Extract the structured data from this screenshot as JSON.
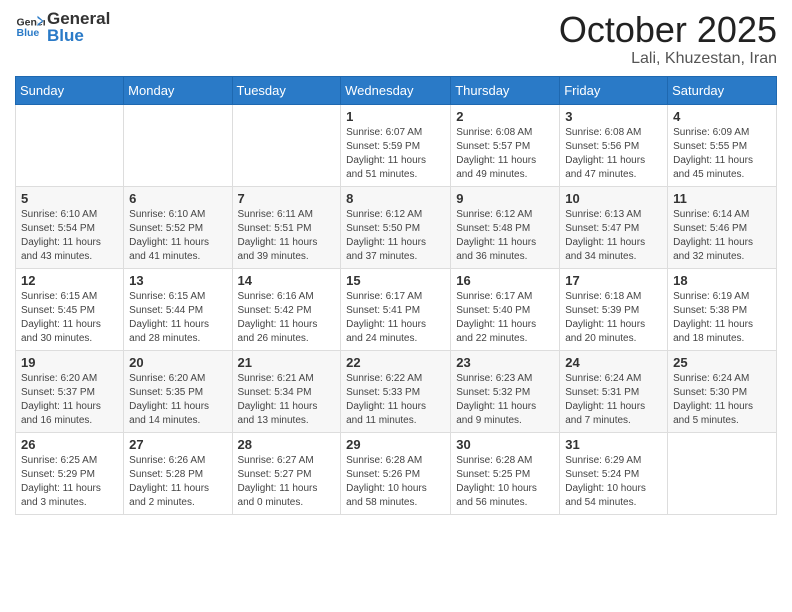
{
  "logo": {
    "general": "General",
    "blue": "Blue"
  },
  "header": {
    "month": "October 2025",
    "location": "Lali, Khuzestan, Iran"
  },
  "weekdays": [
    "Sunday",
    "Monday",
    "Tuesday",
    "Wednesday",
    "Thursday",
    "Friday",
    "Saturday"
  ],
  "weeks": [
    [
      {
        "day": "",
        "sunrise": "",
        "sunset": "",
        "daylight": ""
      },
      {
        "day": "",
        "sunrise": "",
        "sunset": "",
        "daylight": ""
      },
      {
        "day": "",
        "sunrise": "",
        "sunset": "",
        "daylight": ""
      },
      {
        "day": "1",
        "sunrise": "Sunrise: 6:07 AM",
        "sunset": "Sunset: 5:59 PM",
        "daylight": "Daylight: 11 hours and 51 minutes."
      },
      {
        "day": "2",
        "sunrise": "Sunrise: 6:08 AM",
        "sunset": "Sunset: 5:57 PM",
        "daylight": "Daylight: 11 hours and 49 minutes."
      },
      {
        "day": "3",
        "sunrise": "Sunrise: 6:08 AM",
        "sunset": "Sunset: 5:56 PM",
        "daylight": "Daylight: 11 hours and 47 minutes."
      },
      {
        "day": "4",
        "sunrise": "Sunrise: 6:09 AM",
        "sunset": "Sunset: 5:55 PM",
        "daylight": "Daylight: 11 hours and 45 minutes."
      }
    ],
    [
      {
        "day": "5",
        "sunrise": "Sunrise: 6:10 AM",
        "sunset": "Sunset: 5:54 PM",
        "daylight": "Daylight: 11 hours and 43 minutes."
      },
      {
        "day": "6",
        "sunrise": "Sunrise: 6:10 AM",
        "sunset": "Sunset: 5:52 PM",
        "daylight": "Daylight: 11 hours and 41 minutes."
      },
      {
        "day": "7",
        "sunrise": "Sunrise: 6:11 AM",
        "sunset": "Sunset: 5:51 PM",
        "daylight": "Daylight: 11 hours and 39 minutes."
      },
      {
        "day": "8",
        "sunrise": "Sunrise: 6:12 AM",
        "sunset": "Sunset: 5:50 PM",
        "daylight": "Daylight: 11 hours and 37 minutes."
      },
      {
        "day": "9",
        "sunrise": "Sunrise: 6:12 AM",
        "sunset": "Sunset: 5:48 PM",
        "daylight": "Daylight: 11 hours and 36 minutes."
      },
      {
        "day": "10",
        "sunrise": "Sunrise: 6:13 AM",
        "sunset": "Sunset: 5:47 PM",
        "daylight": "Daylight: 11 hours and 34 minutes."
      },
      {
        "day": "11",
        "sunrise": "Sunrise: 6:14 AM",
        "sunset": "Sunset: 5:46 PM",
        "daylight": "Daylight: 11 hours and 32 minutes."
      }
    ],
    [
      {
        "day": "12",
        "sunrise": "Sunrise: 6:15 AM",
        "sunset": "Sunset: 5:45 PM",
        "daylight": "Daylight: 11 hours and 30 minutes."
      },
      {
        "day": "13",
        "sunrise": "Sunrise: 6:15 AM",
        "sunset": "Sunset: 5:44 PM",
        "daylight": "Daylight: 11 hours and 28 minutes."
      },
      {
        "day": "14",
        "sunrise": "Sunrise: 6:16 AM",
        "sunset": "Sunset: 5:42 PM",
        "daylight": "Daylight: 11 hours and 26 minutes."
      },
      {
        "day": "15",
        "sunrise": "Sunrise: 6:17 AM",
        "sunset": "Sunset: 5:41 PM",
        "daylight": "Daylight: 11 hours and 24 minutes."
      },
      {
        "day": "16",
        "sunrise": "Sunrise: 6:17 AM",
        "sunset": "Sunset: 5:40 PM",
        "daylight": "Daylight: 11 hours and 22 minutes."
      },
      {
        "day": "17",
        "sunrise": "Sunrise: 6:18 AM",
        "sunset": "Sunset: 5:39 PM",
        "daylight": "Daylight: 11 hours and 20 minutes."
      },
      {
        "day": "18",
        "sunrise": "Sunrise: 6:19 AM",
        "sunset": "Sunset: 5:38 PM",
        "daylight": "Daylight: 11 hours and 18 minutes."
      }
    ],
    [
      {
        "day": "19",
        "sunrise": "Sunrise: 6:20 AM",
        "sunset": "Sunset: 5:37 PM",
        "daylight": "Daylight: 11 hours and 16 minutes."
      },
      {
        "day": "20",
        "sunrise": "Sunrise: 6:20 AM",
        "sunset": "Sunset: 5:35 PM",
        "daylight": "Daylight: 11 hours and 14 minutes."
      },
      {
        "day": "21",
        "sunrise": "Sunrise: 6:21 AM",
        "sunset": "Sunset: 5:34 PM",
        "daylight": "Daylight: 11 hours and 13 minutes."
      },
      {
        "day": "22",
        "sunrise": "Sunrise: 6:22 AM",
        "sunset": "Sunset: 5:33 PM",
        "daylight": "Daylight: 11 hours and 11 minutes."
      },
      {
        "day": "23",
        "sunrise": "Sunrise: 6:23 AM",
        "sunset": "Sunset: 5:32 PM",
        "daylight": "Daylight: 11 hours and 9 minutes."
      },
      {
        "day": "24",
        "sunrise": "Sunrise: 6:24 AM",
        "sunset": "Sunset: 5:31 PM",
        "daylight": "Daylight: 11 hours and 7 minutes."
      },
      {
        "day": "25",
        "sunrise": "Sunrise: 6:24 AM",
        "sunset": "Sunset: 5:30 PM",
        "daylight": "Daylight: 11 hours and 5 minutes."
      }
    ],
    [
      {
        "day": "26",
        "sunrise": "Sunrise: 6:25 AM",
        "sunset": "Sunset: 5:29 PM",
        "daylight": "Daylight: 11 hours and 3 minutes."
      },
      {
        "day": "27",
        "sunrise": "Sunrise: 6:26 AM",
        "sunset": "Sunset: 5:28 PM",
        "daylight": "Daylight: 11 hours and 2 minutes."
      },
      {
        "day": "28",
        "sunrise": "Sunrise: 6:27 AM",
        "sunset": "Sunset: 5:27 PM",
        "daylight": "Daylight: 11 hours and 0 minutes."
      },
      {
        "day": "29",
        "sunrise": "Sunrise: 6:28 AM",
        "sunset": "Sunset: 5:26 PM",
        "daylight": "Daylight: 10 hours and 58 minutes."
      },
      {
        "day": "30",
        "sunrise": "Sunrise: 6:28 AM",
        "sunset": "Sunset: 5:25 PM",
        "daylight": "Daylight: 10 hours and 56 minutes."
      },
      {
        "day": "31",
        "sunrise": "Sunrise: 6:29 AM",
        "sunset": "Sunset: 5:24 PM",
        "daylight": "Daylight: 10 hours and 54 minutes."
      },
      {
        "day": "",
        "sunrise": "",
        "sunset": "",
        "daylight": ""
      }
    ]
  ]
}
